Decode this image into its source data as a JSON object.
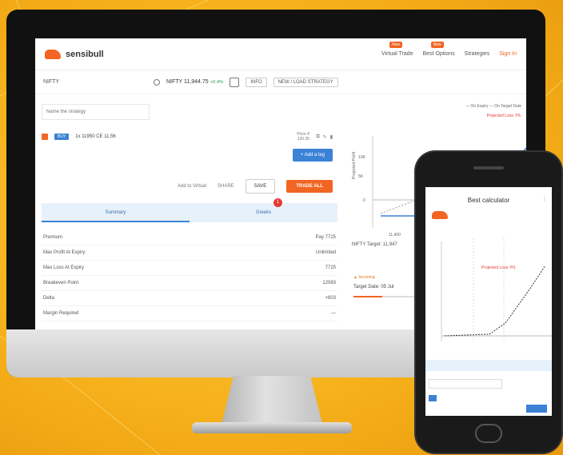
{
  "brand": {
    "name": "sensibull",
    "accent": "#f26522",
    "primary": "#3b82d6"
  },
  "nav": {
    "items": [
      {
        "label": "Virtual Trade",
        "badge": "New"
      },
      {
        "label": "Best Options",
        "badge": "New"
      },
      {
        "label": "Strategies",
        "badge": ""
      },
      {
        "label": "Sign In",
        "badge": ""
      }
    ]
  },
  "search": {
    "value": "NIFTY",
    "ticker": "NIFTY 11,944.75",
    "change": "+0.4%",
    "info_label": "INFO",
    "new_load_label": "NEW / LOAD STRATEGY"
  },
  "strategy": {
    "name_placeholder": "Name the strategy"
  },
  "leg": {
    "badge": "BUY",
    "text": "1x 11950 CE 11.56",
    "price_label": "Price ₹",
    "price": "120.35"
  },
  "add_leg_label": "+ Add a leg",
  "actions": {
    "virtual": "Add to Virtual",
    "share": "SHARE",
    "save": "SAVE",
    "trade": "TRADE ALL"
  },
  "tabs": {
    "summary": "Summary",
    "greeks": "Greeks",
    "notification_count": "1"
  },
  "summary_rows": [
    {
      "label": "Premium",
      "value": "Pay 7725"
    },
    {
      "label": "Max Profit At Expiry",
      "value": "Unlimited"
    },
    {
      "label": "Max Loss At Expiry",
      "value": "7725"
    },
    {
      "label": "Breakeven Point",
      "value": "12083"
    },
    {
      "label": "Delta",
      "value": "+603"
    },
    {
      "label": "Margin Required",
      "value": "—"
    }
  ],
  "graph": {
    "legend": "— On Expiry   — On Target Date",
    "loss_label": "Projected Loss: P/L",
    "ylabel": "Projected Profit",
    "yticks": [
      "10K",
      "5K",
      "0"
    ],
    "xtick": "11,400"
  },
  "target": {
    "label": "NIFTY Target: 11,947",
    "warning": "▲ Incoming",
    "date_label": "Target Date: 05 Jul"
  },
  "phone": {
    "title": "Best calculator",
    "menu": "⋮"
  }
}
